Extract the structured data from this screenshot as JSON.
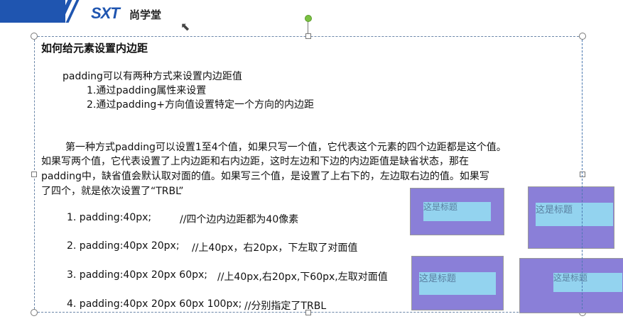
{
  "header": {
    "logo_text": "SXT",
    "logo_cn": "尚学堂"
  },
  "slide": {
    "title": "如何给元素设置内边距",
    "intro": "padding可以有两种方式来设置内边距值",
    "methods": [
      "1.通过padding属性来设置",
      "2.通过padding+方向值设置特定一个方向的内边距"
    ],
    "paragraph": [
      "第一种方式padding可以设置1至4个值，如果只写一个值，它代表这个元素的四个边距都是这个值。",
      "如果写两个值，它代表设置了上内边距和右内边距，这时左边和下边的内边距值是缺省状态，那在",
      "padding中，缺省值会默认取对面的值。如果写三个值，是设置了上右下的，左边取右边的值。如果写",
      "了四个，就是依次设置了“TRBL”"
    ],
    "examples": [
      {
        "code": "1. padding:40px;",
        "comment": "//四个边内边距都为40像素"
      },
      {
        "code": "2. padding:40px 20px;",
        "comment": "//上40px，右20px，下左取了对面值"
      },
      {
        "code": "3. padding:40px 20px 60px;",
        "comment": "//上40px,右20px,下60px,左取对面值"
      },
      {
        "code": "4. padding:40px 20px 60px 100px;",
        "comment": "//分别指定了TRBL"
      }
    ],
    "demo_label": "这是标题"
  }
}
